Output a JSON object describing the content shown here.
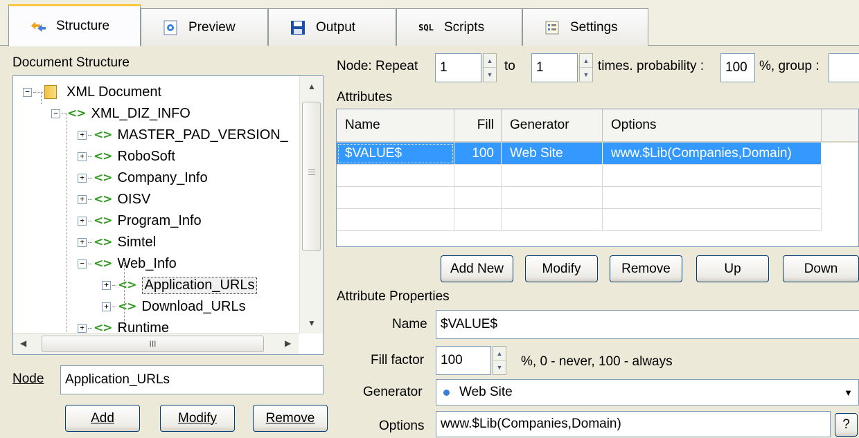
{
  "tabs": [
    {
      "label": "Structure",
      "icon": "structure-icon"
    },
    {
      "label": "Preview",
      "icon": "preview-icon"
    },
    {
      "label": "Output",
      "icon": "floppy-disk-icon"
    },
    {
      "label": "Scripts",
      "icon": "sql-icon"
    },
    {
      "label": "Settings",
      "icon": "settings-icon"
    }
  ],
  "sql_icon_text": "SQL",
  "left": {
    "title": "Document Structure",
    "tree": {
      "root": "XML Document",
      "child": "XML_DIZ_INFO",
      "items": [
        "MASTER_PAD_VERSION_",
        "RoboSoft",
        "Company_Info",
        "OISV",
        "Program_Info",
        "Simtel",
        "Web_Info"
      ],
      "web_children": [
        "Application_URLs",
        "Download_URLs"
      ],
      "last": "Runtime",
      "scroll_grip": "III"
    },
    "node_label": "Node",
    "node_value": "Application_URLs",
    "buttons": {
      "add": "Add",
      "modify": "Modify",
      "remove": "Remove"
    }
  },
  "right": {
    "repeat_label": "Node: Repeat",
    "repeat_from": "1",
    "to_label": "to",
    "repeat_to": "1",
    "times_label": "times. probability :",
    "probability": "100",
    "group_label": "%, group :",
    "attributes_title": "Attributes",
    "columns": [
      "Name",
      "Fill",
      "Generator",
      "Options"
    ],
    "rows": [
      {
        "name": "$VALUE$",
        "fill": "100",
        "generator": "Web Site",
        "options": "www.$Lib(Companies,Domain)"
      }
    ],
    "buttons": {
      "add_new": "Add New",
      "modify": "Modify",
      "remove": "Remove",
      "up": "Up",
      "down": "Down"
    },
    "props_title": "Attribute Properties",
    "name_label": "Name",
    "name_value": "$VALUE$",
    "fill_label": "Fill factor",
    "fill_value": "100",
    "fill_hint": "%, 0 - never, 100 - always",
    "generator_label": "Generator",
    "generator_value": "Web Site",
    "options_label": "Options",
    "options_value": "www.$Lib(Companies,Domain)",
    "help_button": "?"
  }
}
